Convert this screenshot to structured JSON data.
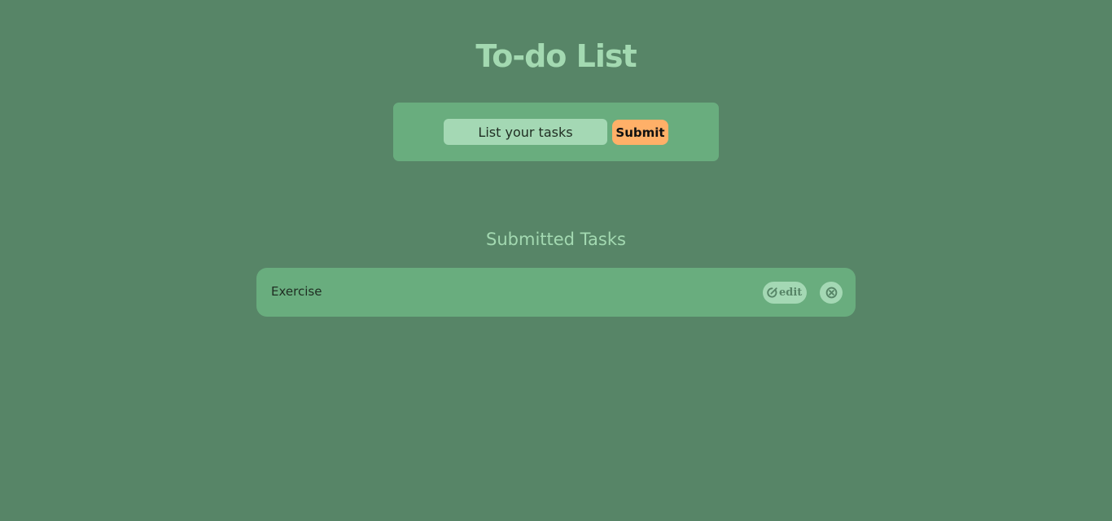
{
  "header": {
    "title": "To-do List"
  },
  "form": {
    "input_value": "",
    "input_placeholder": "List your tasks",
    "submit_label": "Submit"
  },
  "tasks_section": {
    "heading": "Submitted Tasks",
    "items": [
      {
        "text": "Exercise",
        "edit_label": "edit",
        "edit_icon": "edit-icon",
        "delete_icon": "close-circle-icon"
      }
    ]
  },
  "colors": {
    "background": "#578567",
    "card": "#69ad7e",
    "accent_light": "#a4d8b4",
    "submit": "#ffb068"
  }
}
